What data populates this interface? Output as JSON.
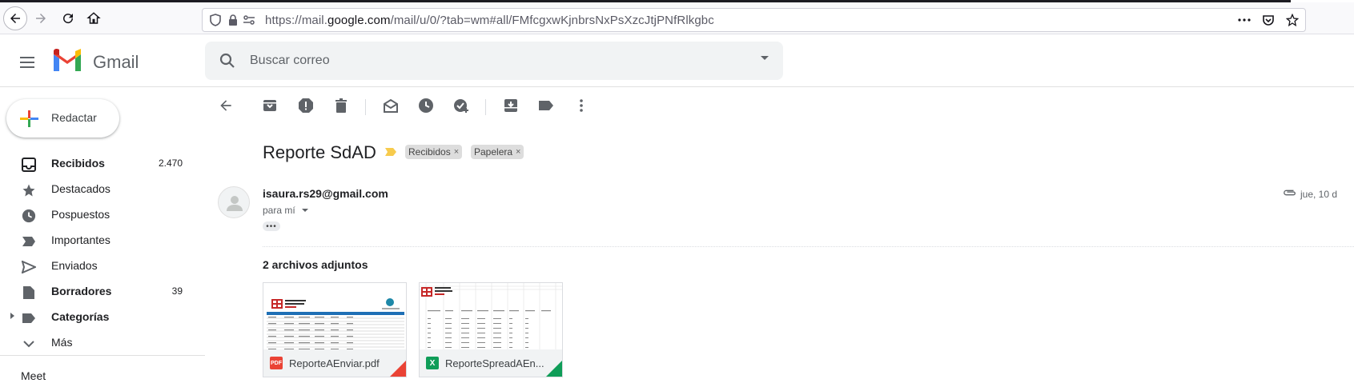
{
  "browser": {
    "url_prefix": "https://mail.",
    "url_domain": "google.com",
    "url_suffix": "/mail/u/0/?tab=wm#all/FMfcgxwKjnbrsNxPsXzcJtjPNfRlkgbc"
  },
  "header": {
    "app_name": "Gmail",
    "search_placeholder": "Buscar correo"
  },
  "sidebar": {
    "compose_label": "Redactar",
    "items": [
      {
        "label": "Recibidos",
        "count": "2.470",
        "icon": "inbox-icon"
      },
      {
        "label": "Destacados",
        "count": "",
        "icon": "star-icon"
      },
      {
        "label": "Pospuestos",
        "count": "",
        "icon": "clock-icon"
      },
      {
        "label": "Importantes",
        "count": "",
        "icon": "important-icon"
      },
      {
        "label": "Enviados",
        "count": "",
        "icon": "send-icon"
      },
      {
        "label": "Borradores",
        "count": "39",
        "icon": "draft-icon"
      },
      {
        "label": "Categorías",
        "count": "",
        "icon": "label-icon"
      },
      {
        "label": "Más",
        "count": "",
        "icon": "chevron-down-icon"
      }
    ],
    "meet_label": "Meet"
  },
  "message": {
    "subject": "Reporte SdAD",
    "labels": [
      "Recibidos",
      "Papelera"
    ],
    "label_remove": "×",
    "sender": "isaura.rs29@gmail.com",
    "to": "para mí",
    "date": "jue, 10 d",
    "ellipsis": "•••",
    "attachments_title": "2 archivos adjuntos",
    "attachments": [
      {
        "name": "ReporteAEnviar.pdf",
        "type": "PDF",
        "color": "#ea4335"
      },
      {
        "name": "ReporteSpreadAEn...",
        "type": "X",
        "color": "#0f9d58"
      }
    ]
  },
  "colors": {
    "gmail_red": "#ea4335",
    "gmail_blue": "#4285f4",
    "gmail_green": "#34a853",
    "gmail_yellow": "#fbbc04",
    "icon_gray": "#5f6368",
    "important_yellow": "#f7cb4d"
  }
}
